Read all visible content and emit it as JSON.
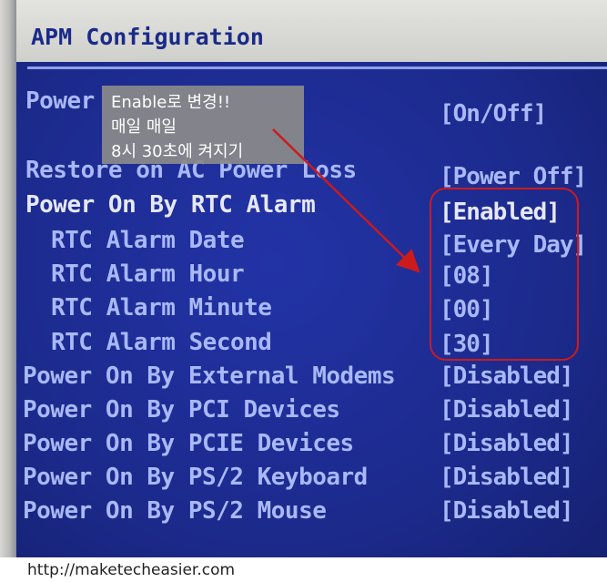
{
  "header": {
    "title": "APM Configuration"
  },
  "settings": [
    {
      "label": "Power",
      "value": "[On/Off]"
    },
    {
      "label": "Restore on AC Power Loss",
      "value": "[Power Off]"
    },
    {
      "label": "Power On By RTC Alarm",
      "value": "[Enabled]"
    },
    {
      "label": "RTC Alarm Date",
      "value": "[Every Day]"
    },
    {
      "label": "RTC Alarm Hour",
      "value": "[08]"
    },
    {
      "label": "RTC Alarm Minute",
      "value": "[00]"
    },
    {
      "label": "RTC Alarm Second",
      "value": "[30]"
    },
    {
      "label": "Power On By External Modems",
      "value": "[Disabled]"
    },
    {
      "label": "Power On By PCI Devices",
      "value": "[Disabled]"
    },
    {
      "label": "Power On By PCIE Devices",
      "value": "[Disabled]"
    },
    {
      "label": "Power On By PS/2 Keyboard",
      "value": "[Disabled]"
    },
    {
      "label": "Power On By PS/2 Mouse",
      "value": "[Disabled]"
    }
  ],
  "annotation": {
    "line1": "Enable로 변경!!",
    "line2": "매일 매일",
    "line3": "8시 30초에 켜지기"
  },
  "footer": {
    "url": "http://maketecheasier.com"
  },
  "colors": {
    "bios_background": "#1e2c8e",
    "label_blue": "#a9b8f7",
    "label_white": "#e6e8f7",
    "highlight_red": "#cc1b1b",
    "callout_gray": "#8a8a8a"
  }
}
